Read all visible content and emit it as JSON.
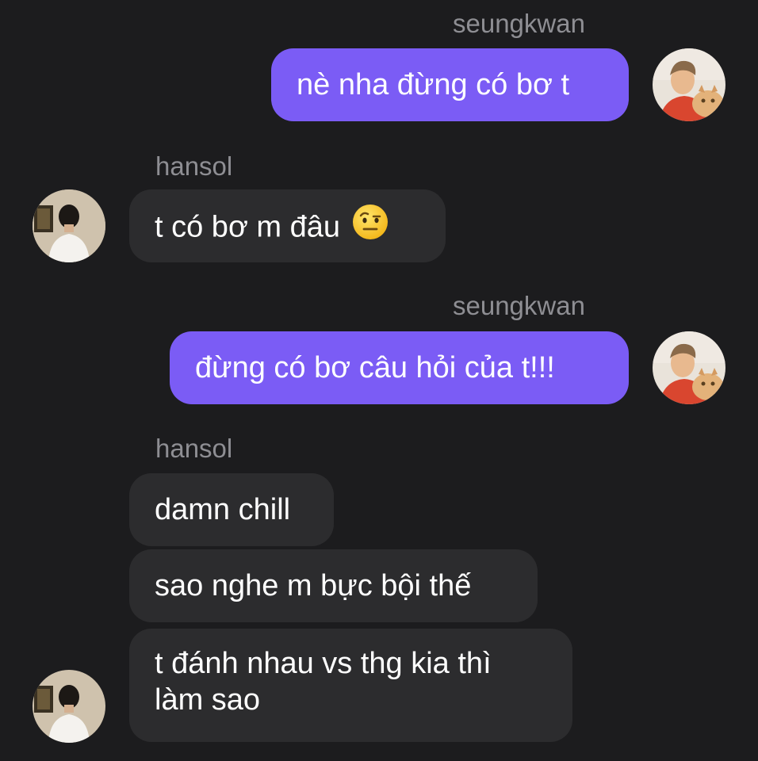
{
  "messages": [
    {
      "sender": "seungkwan",
      "side": "out",
      "text": "nè nha đừng có bơ t"
    },
    {
      "sender": "hansol",
      "side": "in",
      "text": "t có bơ m đâu",
      "emoji": "face-with-raised-eyebrow"
    },
    {
      "sender": "seungkwan",
      "side": "out",
      "text": "đừng có bơ câu hỏi của t!!!"
    },
    {
      "sender": "hansol",
      "side": "in",
      "text": "damn chill"
    },
    {
      "sender": "hansol",
      "side": "in",
      "text": "sao nghe m bực bội thế"
    },
    {
      "sender": "hansol",
      "side": "in",
      "text": "t đánh nhau vs thg kia thì làm sao"
    }
  ],
  "colors": {
    "background": "#1c1c1e",
    "outgoing_bubble": "#7b5cf5",
    "incoming_bubble": "#2c2c2e",
    "sender_name": "#8e8e93"
  }
}
